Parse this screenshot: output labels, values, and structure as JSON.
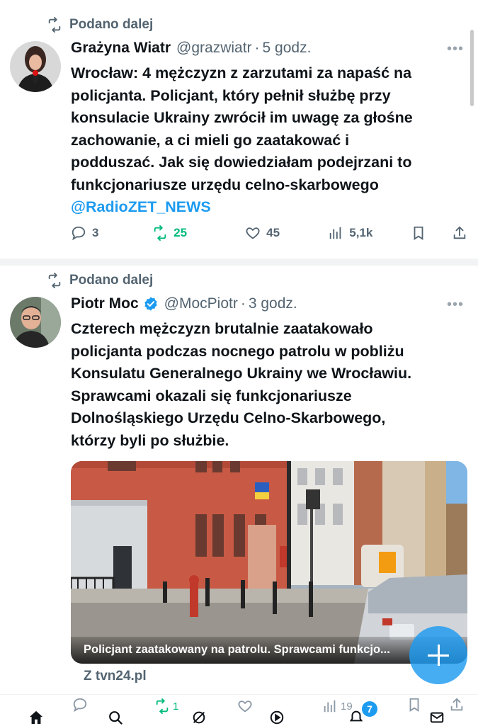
{
  "tweets": [
    {
      "retweet_label": "Podano dalej",
      "name": "Grażyna Wiatr",
      "verified": false,
      "handle": "@grazwiatr",
      "time": "5 godz.",
      "text_lines": [
        "Wrocław: 4 mężczyzn z zarzutami za napaść na",
        "policjanta. Policjant, który pełnił służbę przy",
        "konsulacie Ukrainy zwrócił im uwagę za głośne",
        "zachowanie, a ci mieli go zaatakować i",
        "podduszać. Jak się dowiedziałam podejrzani to",
        "funkcjonariusze urzędu celno-skarbowego"
      ],
      "mention": "@RadioZET_NEWS",
      "replies": "3",
      "retweets": "25",
      "likes": "45",
      "views": "5,1k"
    },
    {
      "retweet_label": "Podano dalej",
      "name": "Piotr Moc",
      "verified": true,
      "handle": "@MocPiotr",
      "time": "3 godz.",
      "text_lines": [
        "Czterech mężczyzn brutalnie zaatakowało",
        "policjanta podczas nocnego patrolu w pobliżu",
        "Konsulatu Generalnego Ukrainy we Wrocławiu.",
        "Sprawcami okazali się funkcjonariusze",
        "Dolnośląskiego Urzędu Celno-Skarbowego,",
        "którzy byli po służbie."
      ],
      "media_caption": "Policjant zaatakowany na patrolu. Sprawcami funkcjo...",
      "source": "Z tvn24.pl"
    }
  ],
  "bottom_bar": {
    "retweets": "1",
    "views": "19",
    "notifications_badge": "7"
  },
  "colors": {
    "accent": "#1d9bf0",
    "retweet_green": "#00ba7c",
    "muted": "#536471"
  }
}
